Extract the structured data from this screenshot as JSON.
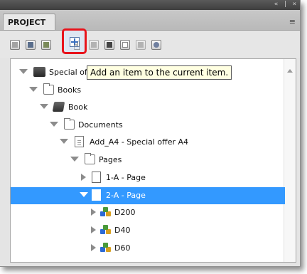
{
  "window": {
    "controls": "« | ×",
    "tab_label": "PROJECT",
    "tab_menu_icon": "≡"
  },
  "toolbar": {
    "buttons": [
      "open-item",
      "save-item",
      "edit-item",
      "add-item",
      "add-page",
      "delete-item",
      "new-item",
      "view-item",
      "refresh-item"
    ],
    "highlighted": "add-item"
  },
  "tooltip": {
    "text": "Add an item to the current item."
  },
  "tree": {
    "items": [
      {
        "label": "Special of",
        "icon": "special-offer-icon",
        "expanded": true
      },
      {
        "label": "Books",
        "icon": "folder-icon",
        "expanded": true
      },
      {
        "label": "Book",
        "icon": "book-icon",
        "expanded": true
      },
      {
        "label": "Documents",
        "icon": "folder-icon",
        "expanded": true
      },
      {
        "label": "Add_A4 - Special offer A4",
        "icon": "document-icon",
        "expanded": true
      },
      {
        "label": "Pages",
        "icon": "folder-icon",
        "expanded": true
      },
      {
        "label": "1-A - Page",
        "icon": "page-icon",
        "expanded": false
      },
      {
        "label": "2-A - Page",
        "icon": "page-icon",
        "expanded": true,
        "selected": true
      },
      {
        "label": "D200",
        "icon": "cubes-icon",
        "expanded": false
      },
      {
        "label": "D40",
        "icon": "cubes-icon",
        "expanded": false
      },
      {
        "label": "D60",
        "icon": "cubes-icon",
        "expanded": false
      }
    ]
  },
  "colors": {
    "selection": "#3399ff",
    "highlight_border": "#e8131b",
    "tooltip_bg": "#ffffe1"
  }
}
